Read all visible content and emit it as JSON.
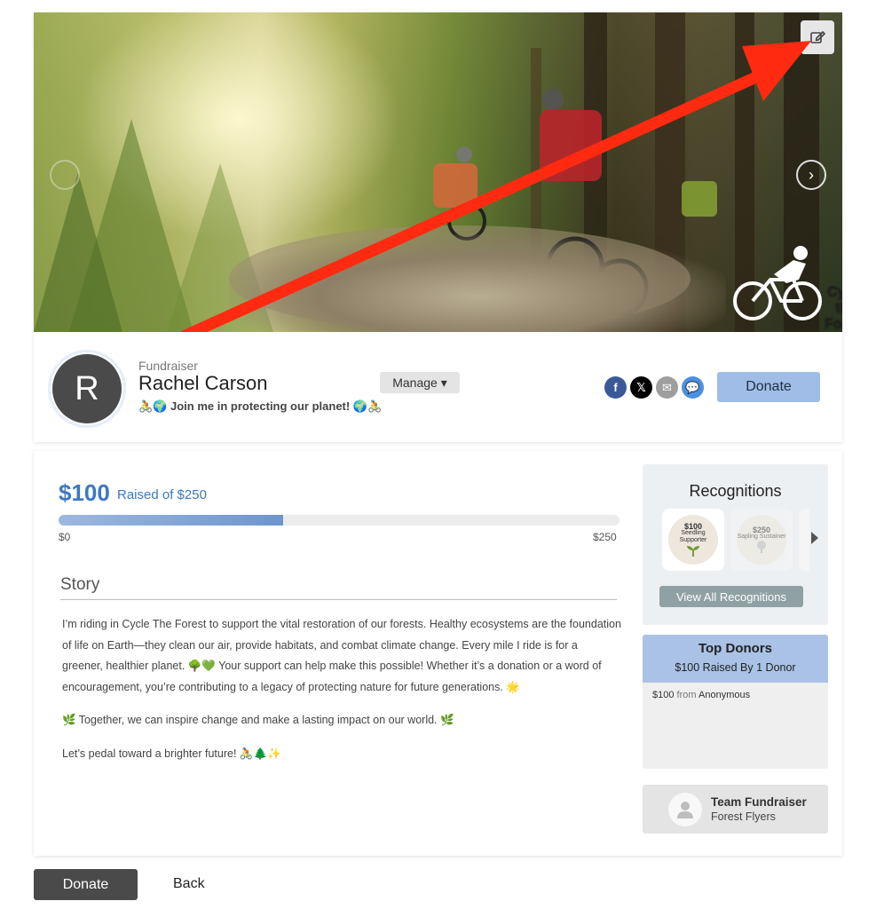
{
  "banner": {
    "event_name": "Cycle the Forest",
    "edit_icon": "edit-icon",
    "prev_icon": "chevron-left-icon",
    "next_icon": "chevron-right-icon"
  },
  "profile": {
    "avatar_initial": "R",
    "role": "Fundraiser",
    "name": "Rachel Carson",
    "tagline": "🚴🌍 Join me in protecting our planet! 🌍🚴",
    "manage_label": "Manage ▾",
    "share": {
      "facebook": "f",
      "x": "𝕏",
      "email": "✉",
      "sms": "💬"
    },
    "donate_label": "Donate"
  },
  "progress": {
    "raised": "$100",
    "raised_of": "Raised of $250",
    "fraction": 0.4,
    "min_label": "$0",
    "max_label": "$250"
  },
  "story": {
    "title": "Story",
    "paragraphs": [
      "I’m riding in Cycle The Forest to support the vital restoration of our forests. Healthy ecosystems are the foundation of life on Earth—they clean our air, provide habitats, and combat climate change. Every mile I ride is for a greener, healthier planet. 🌳💚 Your support can help make this possible! Whether it’s a donation or a word of encouragement, you’re contributing to a legacy of protecting nature for future generations. 🌟",
      "🌿 Together, we can inspire change and make a lasting impact on our world. 🌿",
      "Let’s pedal toward a brighter future! 🚴🌲✨"
    ]
  },
  "recognitions": {
    "title": "Recognitions",
    "badges": [
      {
        "amount": "$100",
        "label": "Seedling Supporter"
      },
      {
        "amount": "$250",
        "label": "Sapling Sustainer"
      }
    ],
    "view_all_label": "View All Recognitions"
  },
  "top_donors": {
    "title": "Top Donors",
    "subtitle": "$100 Raised By 1 Donor",
    "rows": [
      {
        "amount": "$100",
        "from": "from",
        "name": "Anonymous"
      }
    ]
  },
  "team": {
    "title": "Team Fundraiser",
    "name": "Forest Flyers"
  },
  "footer": {
    "donate_label": "Donate",
    "back_label": "Back"
  },
  "colors": {
    "accent": "#3b78c3",
    "donate_top": "#9fbde6",
    "donate_bottom": "#4a4a4a",
    "annotation_arrow": "#ff2a10"
  }
}
